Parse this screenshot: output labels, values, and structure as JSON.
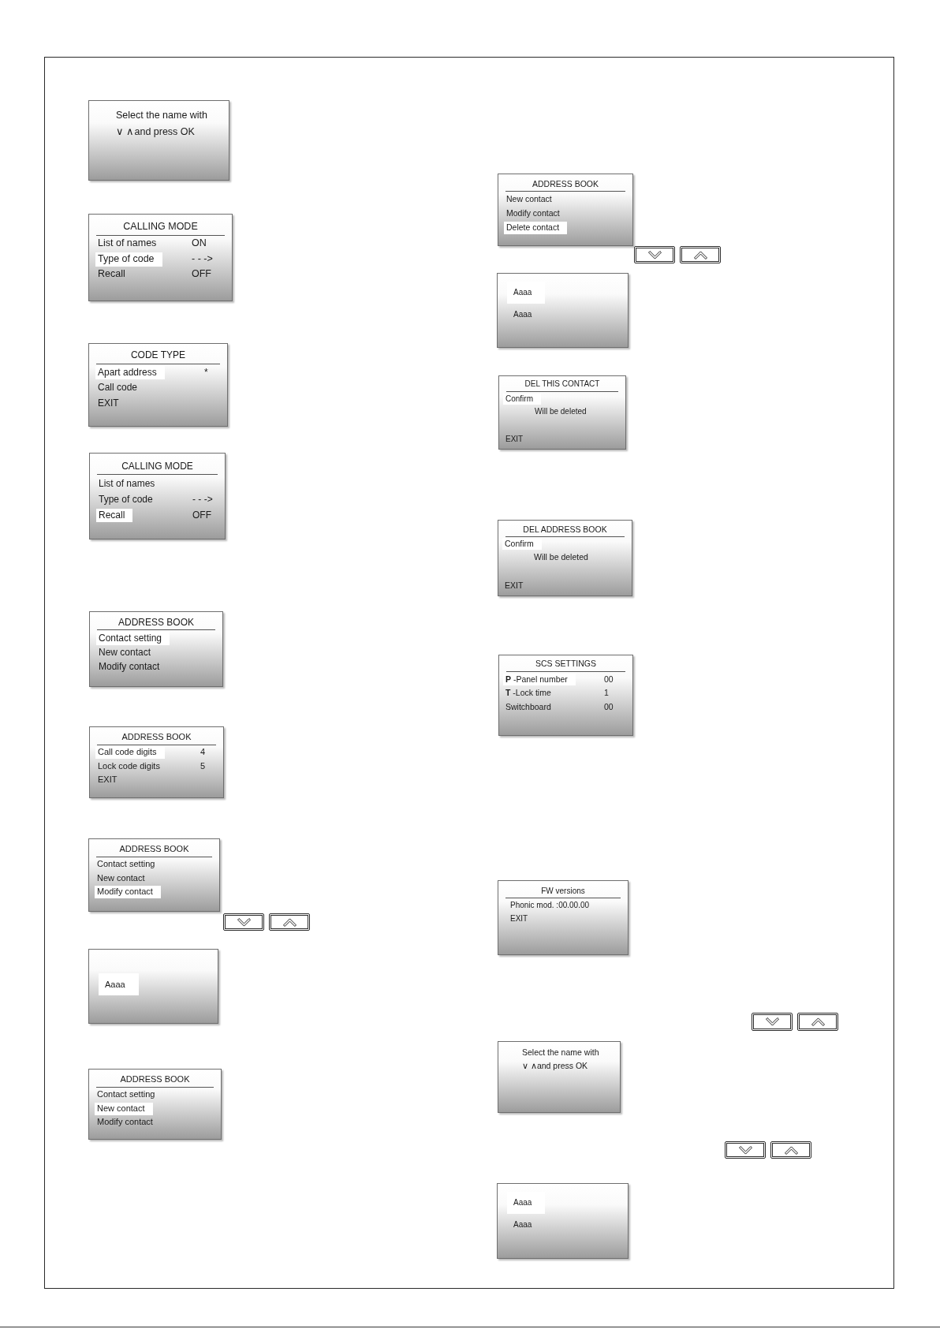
{
  "left_column": [
    {
      "kind": "message",
      "lines": [
        "Select the name with",
        "∨ ∧and press OK"
      ]
    },
    {
      "kind": "menu",
      "title": "CALLING MODE",
      "rows": [
        {
          "kind": "option",
          "label": "List of names",
          "value": "ON",
          "selected": false
        },
        {
          "kind": "option",
          "label": "Type of code",
          "value": "- - ->",
          "selected": true
        },
        {
          "kind": "option",
          "label": "Recall",
          "value": "OFF",
          "selected": false
        }
      ]
    },
    {
      "kind": "menu",
      "title": "CODE TYPE",
      "rows": [
        {
          "kind": "option",
          "label": "Apart address",
          "value": "*",
          "selected": true
        },
        {
          "kind": "option",
          "label": "Call code",
          "selected": false
        },
        {
          "kind": "option",
          "label": "EXIT",
          "selected": false
        }
      ]
    },
    {
      "kind": "menu",
      "title": "CALLING MODE",
      "rows": [
        {
          "kind": "option",
          "label": "List of names",
          "selected": false
        },
        {
          "kind": "option",
          "label": "Type of code",
          "value": "- - ->",
          "selected": false
        },
        {
          "kind": "option",
          "label": "Recall",
          "value": "OFF",
          "selected": true
        }
      ]
    },
    {
      "kind": "menu",
      "title": "ADDRESS BOOK",
      "rows": [
        {
          "kind": "option",
          "label": "Contact setting",
          "selected": true
        },
        {
          "kind": "option",
          "label": "New contact",
          "selected": false
        },
        {
          "kind": "option",
          "label": "Modify contact",
          "selected": false
        }
      ]
    },
    {
      "kind": "menu",
      "title": "ADDRESS BOOK",
      "rows": [
        {
          "kind": "option",
          "label": "Call code digits",
          "value": "4",
          "selected": true
        },
        {
          "kind": "option",
          "label": "Lock code digits",
          "value": "5",
          "selected": false
        },
        {
          "kind": "option",
          "label": "EXIT",
          "selected": false
        }
      ]
    },
    {
      "kind": "menu",
      "title": "ADDRESS BOOK",
      "rows": [
        {
          "kind": "option",
          "label": "Contact setting",
          "selected": false
        },
        {
          "kind": "option",
          "label": "New contact",
          "selected": false
        },
        {
          "kind": "option",
          "label": "Modify contact",
          "selected": true
        }
      ]
    },
    {
      "kind": "nav_keys"
    },
    {
      "kind": "names",
      "entries": [
        {
          "label": "Aaaa",
          "selected": true
        }
      ]
    },
    {
      "kind": "menu",
      "title": "ADDRESS BOOK",
      "rows": [
        {
          "kind": "option",
          "label": "Contact setting",
          "selected": false
        },
        {
          "kind": "option",
          "label": "New contact",
          "selected": true
        },
        {
          "kind": "option",
          "label": "Modify contact",
          "selected": false
        }
      ]
    }
  ],
  "right_column": [
    {
      "kind": "menu",
      "title": "ADDRESS BOOK",
      "rows": [
        {
          "kind": "option",
          "label": "New contact",
          "selected": false
        },
        {
          "kind": "option",
          "label": "Modify contact",
          "selected": false
        },
        {
          "kind": "option",
          "label": "Delete contact",
          "selected": true
        }
      ]
    },
    {
      "kind": "nav_keys"
    },
    {
      "kind": "names",
      "entries": [
        {
          "label": "Aaaa",
          "selected": true
        },
        {
          "label": "Aaaa",
          "selected": false
        }
      ]
    },
    {
      "kind": "menu",
      "title": "DEL THIS CONTACT",
      "rows": [
        {
          "kind": "option",
          "label": "Confirm",
          "selected": true
        },
        {
          "kind": "note",
          "label": "Will be deleted"
        },
        {
          "kind": "footer",
          "label": "EXIT",
          "selected": false
        }
      ]
    },
    {
      "kind": "menu",
      "title": "DEL ADDRESS BOOK",
      "rows": [
        {
          "kind": "option",
          "label": "Confirm",
          "selected": true
        },
        {
          "kind": "note",
          "label": "Will be deleted"
        },
        {
          "kind": "footer",
          "label": "EXIT",
          "selected": false
        }
      ]
    },
    {
      "kind": "menu",
      "title": "SCS SETTINGS",
      "rows": [
        {
          "kind": "option",
          "label": "**P** -Panel number",
          "value": "00",
          "selected": true
        },
        {
          "kind": "option",
          "label": "**T** -Lock time",
          "value": "1",
          "selected": false
        },
        {
          "kind": "option",
          "label": "Switchboard",
          "value": "00",
          "selected": false
        }
      ]
    },
    {
      "kind": "menu",
      "title": "FW versions",
      "rows": [
        {
          "kind": "option",
          "label": "Phonic mod. :00.00.00",
          "selected": false
        },
        {
          "kind": "option",
          "label": "EXIT",
          "selected": false
        }
      ]
    },
    {
      "kind": "nav_keys"
    },
    {
      "kind": "message",
      "lines": [
        "Select the name with",
        "∨ ∧and press OK"
      ]
    },
    {
      "kind": "nav_keys"
    },
    {
      "kind": "names",
      "entries": [
        {
          "label": "Aaaa",
          "selected": true
        },
        {
          "label": "Aaaa",
          "selected": false
        }
      ]
    }
  ]
}
